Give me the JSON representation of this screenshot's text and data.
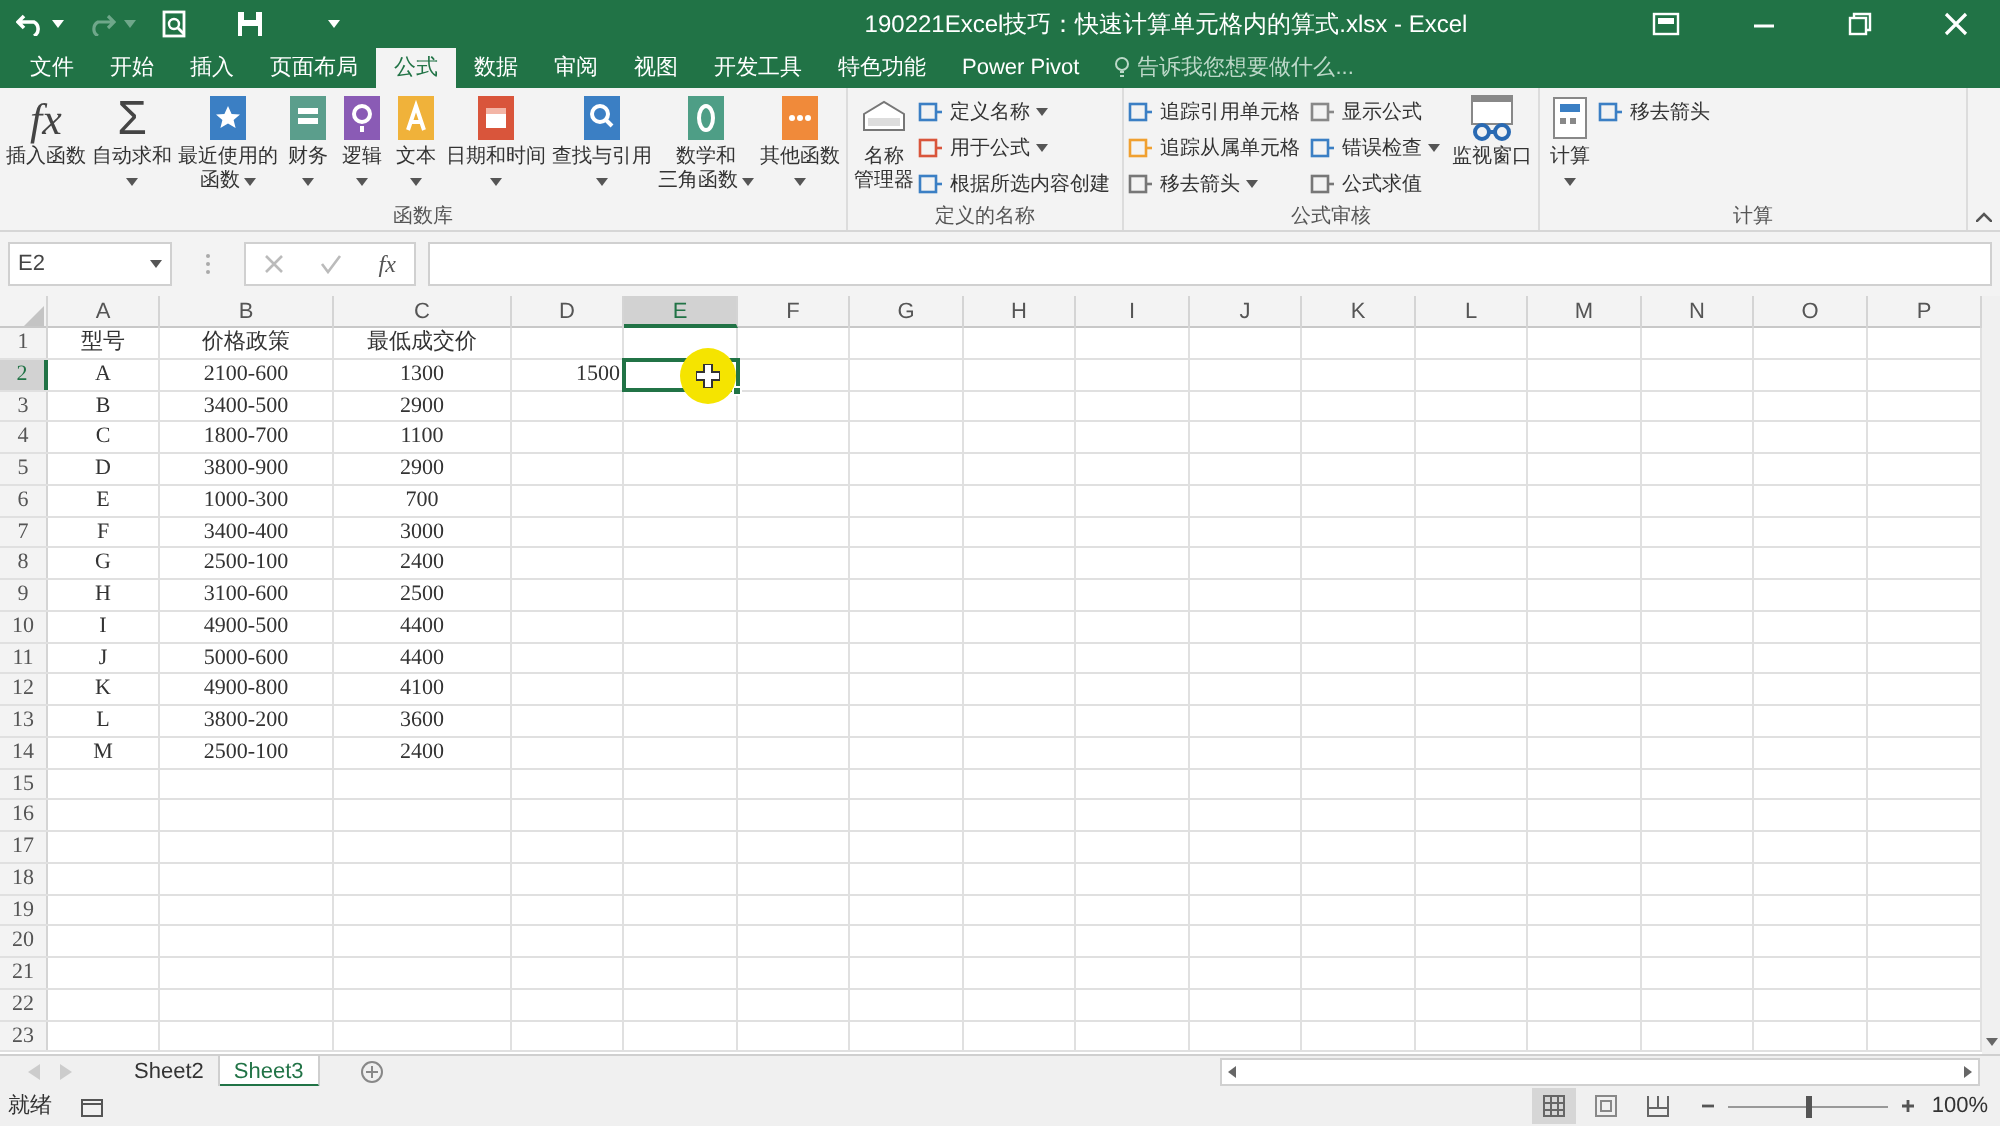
{
  "title_bar": {
    "title": "190221Excel技巧：快速计算单元格内的算式.xlsx - Excel",
    "redo_disabled": true
  },
  "tabs": [
    {
      "label": "文件",
      "selected": false
    },
    {
      "label": "开始",
      "selected": false
    },
    {
      "label": "插入",
      "selected": false
    },
    {
      "label": "页面布局",
      "selected": false
    },
    {
      "label": "公式",
      "selected": true
    },
    {
      "label": "数据",
      "selected": false
    },
    {
      "label": "审阅",
      "selected": false
    },
    {
      "label": "视图",
      "selected": false
    },
    {
      "label": "开发工具",
      "selected": false
    },
    {
      "label": "特色功能",
      "selected": false
    },
    {
      "label": "Power Pivot",
      "selected": false
    }
  ],
  "tell_me": {
    "placeholder": "告诉我您想要做什么..."
  },
  "ribbon_groups": [
    {
      "label": "函数库",
      "buttons": [
        {
          "kind": "large",
          "glyph": "fx",
          "lines": [
            "插入函数"
          ],
          "dropdown": false
        },
        {
          "kind": "large",
          "glyph": "Σ",
          "lines": [
            "自动求和"
          ],
          "dropdown": true
        },
        {
          "kind": "large",
          "lines": [
            "最近使用的",
            "函数"
          ],
          "dropdown": true
        },
        {
          "kind": "large",
          "lines": [
            "财务"
          ],
          "dropdown": true
        },
        {
          "kind": "large",
          "lines": [
            "逻辑"
          ],
          "dropdown": true
        },
        {
          "kind": "large",
          "lines": [
            "文本"
          ],
          "dropdown": true
        },
        {
          "kind": "large",
          "lines": [
            "日期和时间"
          ],
          "dropdown": true
        },
        {
          "kind": "large",
          "lines": [
            "查找与引用"
          ],
          "dropdown": true
        },
        {
          "kind": "large",
          "lines": [
            "数学和",
            "三角函数"
          ],
          "dropdown": true
        },
        {
          "kind": "large",
          "lines": [
            "其他函数"
          ],
          "dropdown": true
        }
      ]
    },
    {
      "label": "定义的名称",
      "buttons": [
        {
          "kind": "large",
          "lines": [
            "名称",
            "管理器"
          ],
          "dropdown": false
        },
        {
          "kind": "small",
          "lines": [
            "定义名称"
          ],
          "dropdown": true
        },
        {
          "kind": "small",
          "lines": [
            "用于公式"
          ],
          "dropdown": true
        },
        {
          "kind": "small",
          "lines": [
            "根据所选内容创建"
          ],
          "dropdown": false
        }
      ]
    },
    {
      "label": "公式审核",
      "buttons": [
        {
          "kind": "small",
          "lines": [
            "追踪引用单元格"
          ],
          "dropdown": false
        },
        {
          "kind": "small",
          "lines": [
            "追踪从属单元格"
          ],
          "dropdown": false
        },
        {
          "kind": "small",
          "lines": [
            "移去箭头"
          ],
          "dropdown": true
        },
        {
          "kind": "small",
          "lines": [
            "显示公式"
          ],
          "dropdown": false
        },
        {
          "kind": "small",
          "lines": [
            "错误检查"
          ],
          "dropdown": true
        },
        {
          "kind": "small",
          "lines": [
            "公式求值"
          ],
          "dropdown": false
        },
        {
          "kind": "large",
          "lines": [
            "监视窗口"
          ],
          "dropdown": false
        }
      ]
    },
    {
      "label": "计算",
      "buttons": [
        {
          "kind": "large",
          "lines": [
            "计算"
          ],
          "dropdown": true
        },
        {
          "kind": "small",
          "lines": [
            "移去箭头"
          ],
          "dropdown": false
        }
      ]
    }
  ],
  "formula_bar": {
    "name_box": "E2",
    "fx": "fx"
  },
  "columns": [
    {
      "label": "A",
      "selected": false
    },
    {
      "label": "B",
      "selected": false
    },
    {
      "label": "C",
      "selected": false
    },
    {
      "label": "D",
      "selected": false
    },
    {
      "label": "E",
      "selected": true
    },
    {
      "label": "F",
      "selected": false
    },
    {
      "label": "G",
      "selected": false
    },
    {
      "label": "H",
      "selected": false
    },
    {
      "label": "I",
      "selected": false
    },
    {
      "label": "J",
      "selected": false
    },
    {
      "label": "K",
      "selected": false
    },
    {
      "label": "L",
      "selected": false
    },
    {
      "label": "M",
      "selected": false
    },
    {
      "label": "N",
      "selected": false
    },
    {
      "label": "O",
      "selected": false
    },
    {
      "label": "P",
      "selected": false
    }
  ],
  "rows": [
    {
      "number": "1",
      "selected": false,
      "cells": [
        "型号",
        "价格政策",
        "最低成交价"
      ]
    },
    {
      "number": "2",
      "selected": true,
      "cells": [
        "A",
        "2100-600",
        "1300",
        "1500"
      ]
    },
    {
      "number": "3",
      "selected": false,
      "cells": [
        "B",
        "3400-500",
        "2900"
      ]
    },
    {
      "number": "4",
      "selected": false,
      "cells": [
        "C",
        "1800-700",
        "1100"
      ]
    },
    {
      "number": "5",
      "selected": false,
      "cells": [
        "D",
        "3800-900",
        "2900"
      ]
    },
    {
      "number": "6",
      "selected": false,
      "cells": [
        "E",
        "1000-300",
        "700"
      ]
    },
    {
      "number": "7",
      "selected": false,
      "cells": [
        "F",
        "3400-400",
        "3000"
      ]
    },
    {
      "number": "8",
      "selected": false,
      "cells": [
        "G",
        "2500-100",
        "2400"
      ]
    },
    {
      "number": "9",
      "selected": false,
      "cells": [
        "H",
        "3100-600",
        "2500"
      ]
    },
    {
      "number": "10",
      "selected": false,
      "cells": [
        "I",
        "4900-500",
        "4400"
      ]
    },
    {
      "number": "11",
      "selected": false,
      "cells": [
        "J",
        "5000-600",
        "4400"
      ]
    },
    {
      "number": "12",
      "selected": false,
      "cells": [
        "K",
        "4900-800",
        "4100"
      ]
    },
    {
      "number": "13",
      "selected": false,
      "cells": [
        "L",
        "3800-200",
        "3600"
      ]
    },
    {
      "number": "14",
      "selected": false,
      "cells": [
        "M",
        "2500-100",
        "2400"
      ]
    },
    {
      "number": "15",
      "selected": false
    },
    {
      "number": "16",
      "selected": false
    },
    {
      "number": "17",
      "selected": false
    },
    {
      "number": "18",
      "selected": false
    },
    {
      "number": "19",
      "selected": false
    },
    {
      "number": "20",
      "selected": false
    },
    {
      "number": "21",
      "selected": false
    },
    {
      "number": "22",
      "selected": false
    },
    {
      "number": "23",
      "selected": false
    }
  ],
  "sheet_tabs": [
    {
      "label": "Sheet2",
      "selected": false
    },
    {
      "label": "Sheet3",
      "selected": true
    }
  ],
  "status_bar": {
    "status": "就绪",
    "views": [
      {
        "kind": "normal",
        "selected": true
      },
      {
        "kind": "page_layout",
        "selected": false
      },
      {
        "kind": "page_break",
        "selected": false
      }
    ],
    "zoom": {
      "level": 0.5,
      "reading": "100%"
    }
  }
}
